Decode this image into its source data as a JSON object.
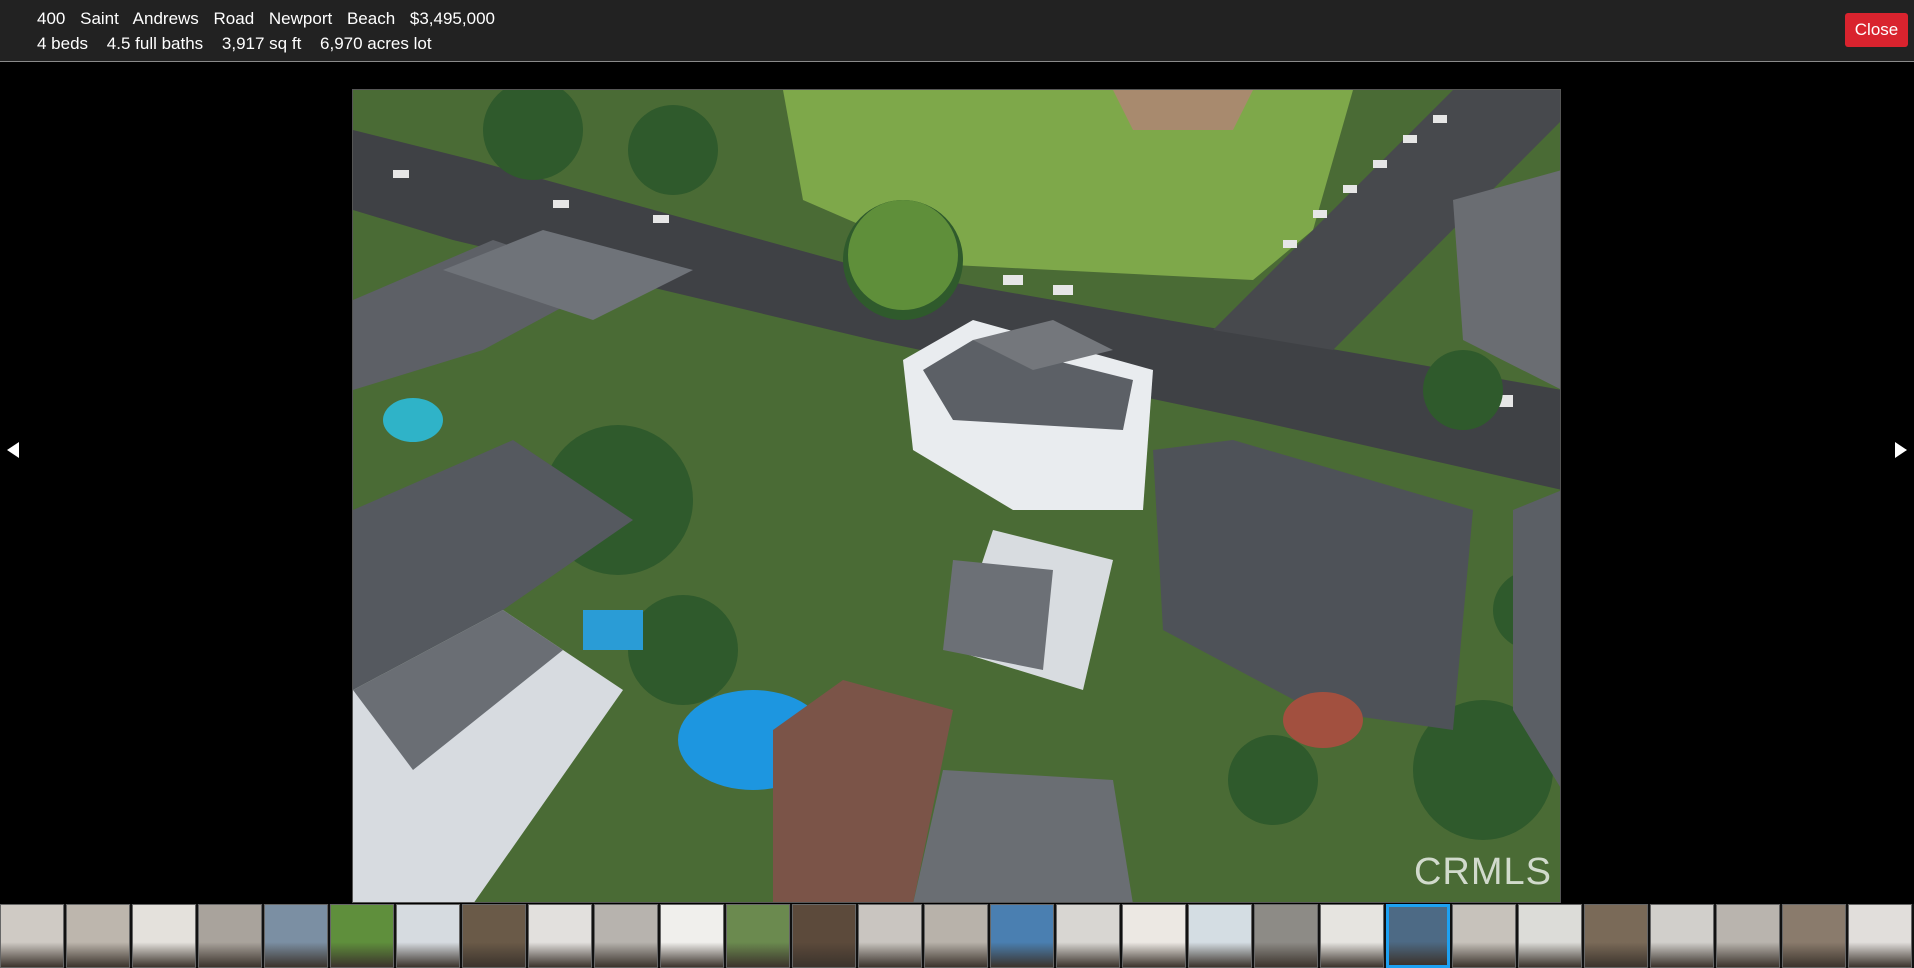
{
  "listing": {
    "address_parts": [
      "400",
      "Saint",
      "Andrews",
      "Road",
      "Newport",
      "Beach",
      "$3,495,000"
    ],
    "details": [
      "4 beds",
      "4.5 full baths",
      "3,917 sq ft",
      "6,970 acres lot"
    ]
  },
  "close_label": "Close",
  "photo": {
    "alt": "Aerial view of property",
    "watermark": "CRMLS"
  },
  "nav": {
    "prev_icon": "triangle-left-icon",
    "next_icon": "triangle-right-icon"
  },
  "thumbnails": {
    "count": 29,
    "active_index": 21,
    "colors": [
      "#cfcac4",
      "#bdb6ad",
      "#e4e1dc",
      "#a9a39c",
      "#7b8fa3",
      "#5f8f3c",
      "#d6dbe0",
      "#6a5a48",
      "#e2e0dd",
      "#b7b3ae",
      "#f0efec",
      "#6b8a4f",
      "#5c4a3b",
      "#c9c5c0",
      "#b8b2aa",
      "#4a7fb1",
      "#d8d6d2",
      "#ece8e3",
      "#d4dde3",
      "#8d8b86",
      "#e6e4e0",
      "#4d6a85",
      "#c7c2bb",
      "#dcdcd8",
      "#7a6a58",
      "#d1cfcb",
      "#b9b4ae",
      "#8a7b6c",
      "#e1dedb"
    ]
  }
}
